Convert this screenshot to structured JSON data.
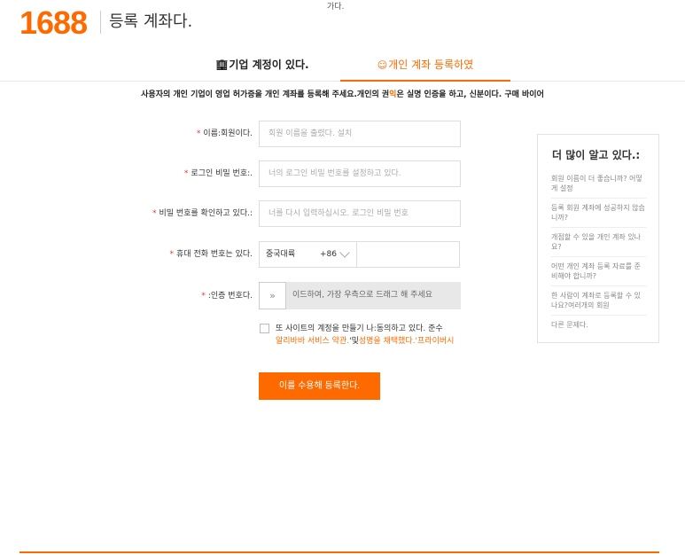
{
  "header": {
    "logo": "1688",
    "title": "등록 계좌다.",
    "top_note": "가다."
  },
  "tabs": [
    {
      "label": "기업 계정이 있다.",
      "icon": "building-icon",
      "active": false
    },
    {
      "label": "개인 계좌 등록하였",
      "icon": "person-icon",
      "active": true
    }
  ],
  "notice": {
    "part1": "사용자의 개인 기업이 영업 허가증을 개인 계좌를 등록해 주세요.개인의 권",
    "highlight": "익",
    "part2": "은 실명 인증을 하고, 신분이다. 구매 바이어"
  },
  "form": {
    "name_label": "이름:회원이다.",
    "name_placeholder": "회원 이름을 출렸다. 설치",
    "password_label": "로그인 비밀 번호:.",
    "password_placeholder": "너의 로그인 비밀 번호를 설정하고 있다.",
    "confirm_label": "비밀 번호를 확인하고 있다.:",
    "confirm_placeholder": "너를 다시 입력하십시오. 로그인 비밀 번호",
    "phone_label": "휴대 전화 번호는 있다.",
    "phone_country": "중국대륙",
    "phone_code": "+86",
    "verify_label": ":인증 번호다.",
    "slider_handle": "»",
    "slider_text": "이드하여, 가장 우측으로 드래그 해 주세요",
    "required_mark": "*"
  },
  "agreement": {
    "text": "또 사이트의 계정을 만들기 나:동의하고 있다. 준수",
    "link1": "알리바바 서비스 약관.",
    "mid": "'및",
    "link2": "성명을 채택했다.'프라이버시"
  },
  "submit_label": "이를 수용해 등록한다.",
  "help": {
    "title": "더 많이 알고 있다.:",
    "items": [
      "회원 이름이 더 좋습니까? 어떻게 설정",
      "등록 회원 계좌에 성공하지 않습니까?",
      "개점할 수 있을 개인 계좌 있나요?",
      "어떤 개인 계좌 등록 자료를 준비해야 합니까?",
      "한 사람이 계좌로 등록할 수 있나요?여러개의 회원",
      "다른 문제다."
    ]
  },
  "colors": {
    "accent": "#ff6a00",
    "required": "#e4393c"
  }
}
